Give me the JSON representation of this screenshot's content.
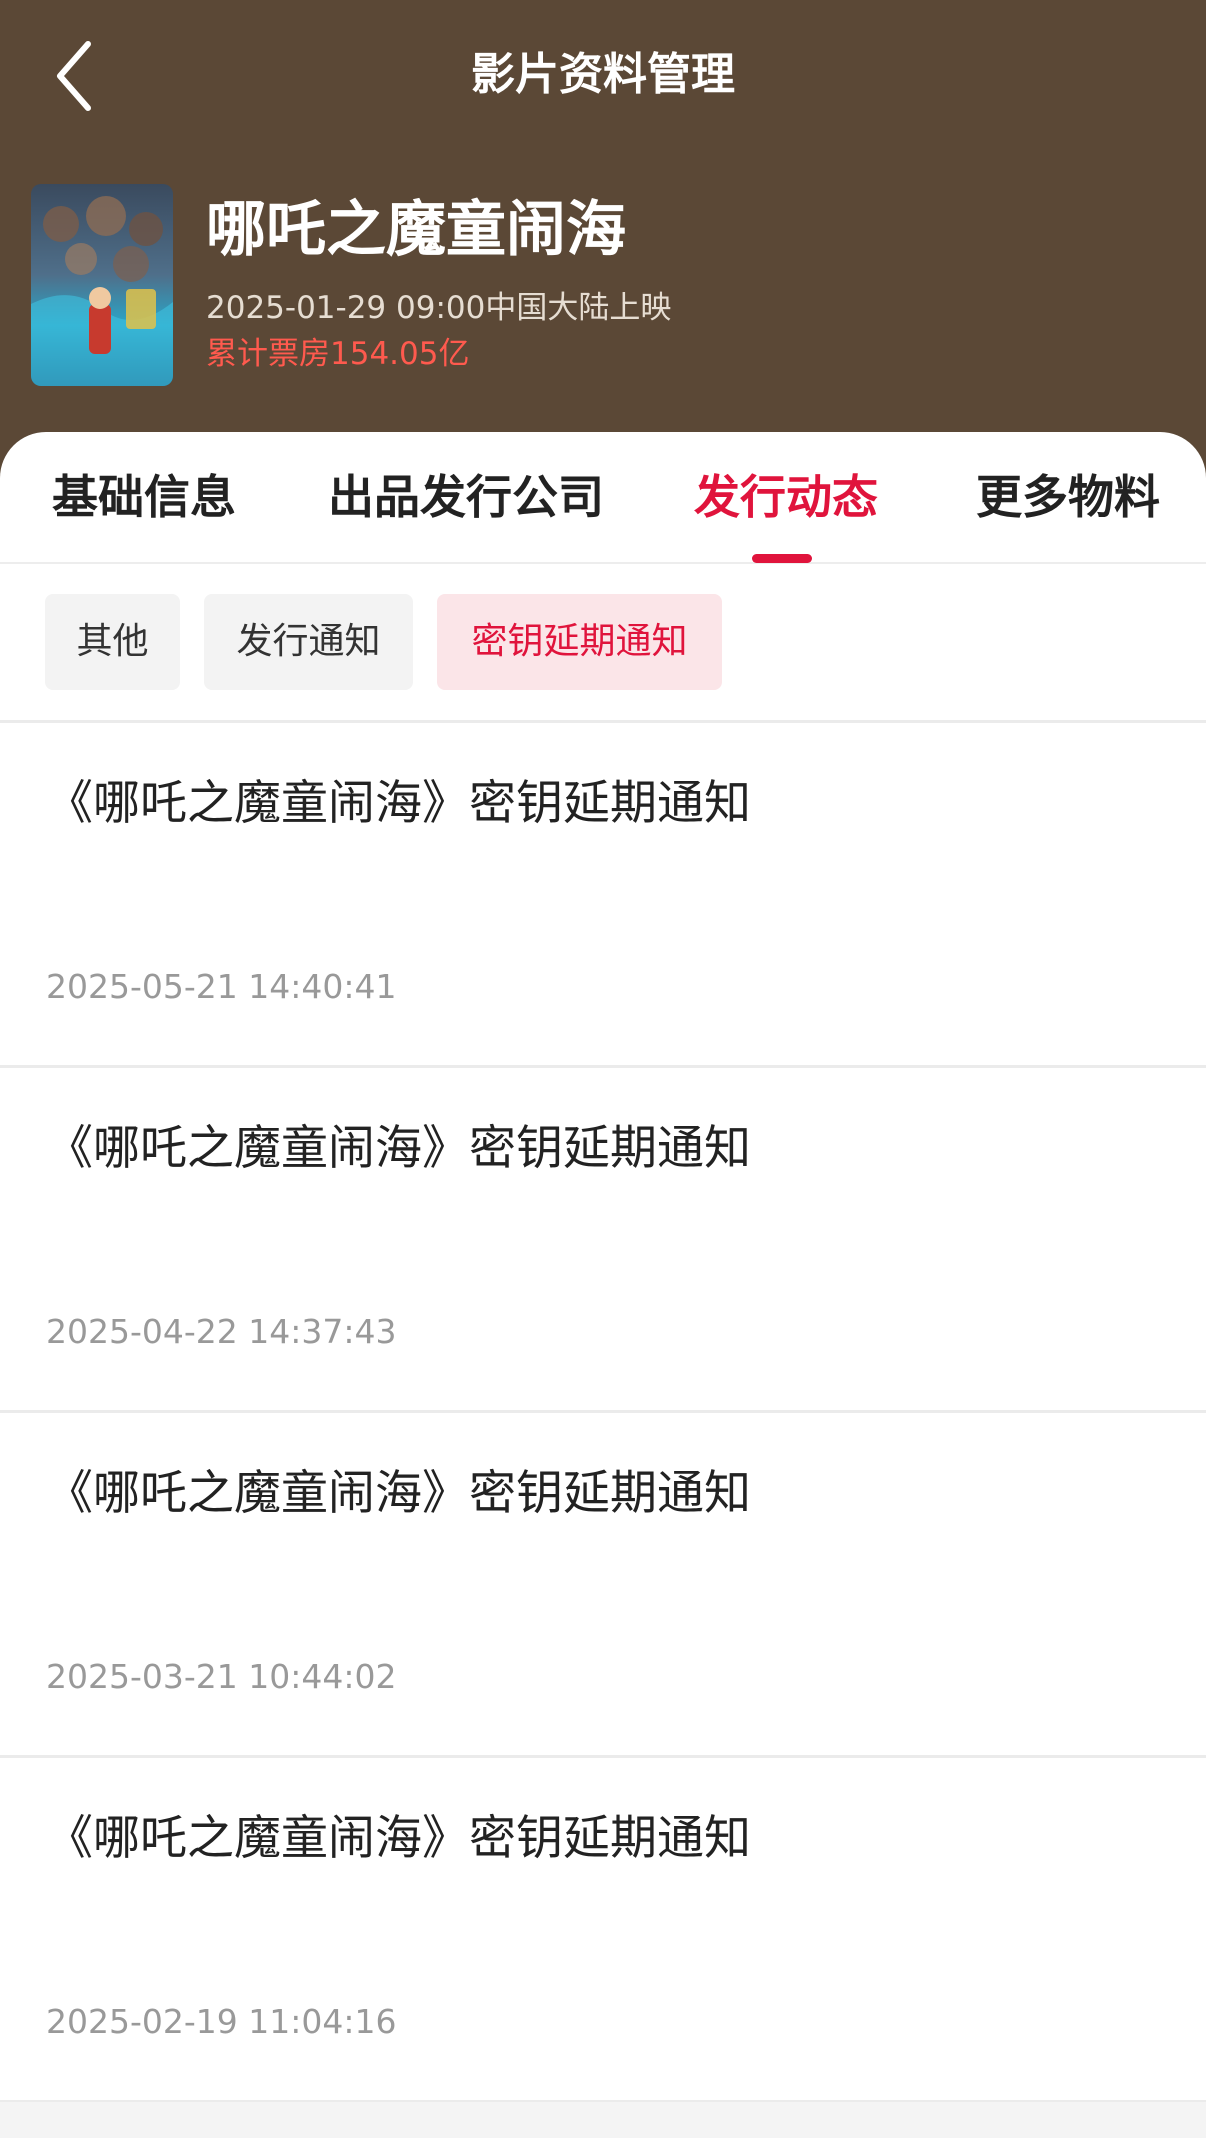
{
  "nav": {
    "title": "影片资料管理",
    "back_icon": "chevron-left-icon"
  },
  "movie": {
    "title": "哪吒之魔童闹海",
    "release_info": "2025-01-29 09:00中国大陆上映",
    "box_office": "累计票房154.05亿",
    "poster": "movie-poster"
  },
  "tabs": [
    {
      "label": "基础信息",
      "active": false
    },
    {
      "label": "出品发行公司",
      "active": false
    },
    {
      "label": "发行动态",
      "active": true
    },
    {
      "label": "更多物料",
      "active": false
    }
  ],
  "filters": [
    {
      "label": "其他",
      "active": false
    },
    {
      "label": "发行通知",
      "active": false
    },
    {
      "label": "密钥延期通知",
      "active": true
    }
  ],
  "notices": [
    {
      "title": "《哪吒之魔童闹海》密钥延期通知",
      "time": "2025-05-21 14:40:41"
    },
    {
      "title": "《哪吒之魔童闹海》密钥延期通知",
      "time": "2025-04-22 14:37:43"
    },
    {
      "title": "《哪吒之魔童闹海》密钥延期通知",
      "time": "2025-03-21 10:44:02"
    },
    {
      "title": "《哪吒之魔童闹海》密钥延期通知",
      "time": "2025-02-19 11:04:16"
    }
  ],
  "colors": {
    "header_bg": "#5b4836",
    "accent": "#e0143c",
    "box_office": "#ff5a4e"
  }
}
